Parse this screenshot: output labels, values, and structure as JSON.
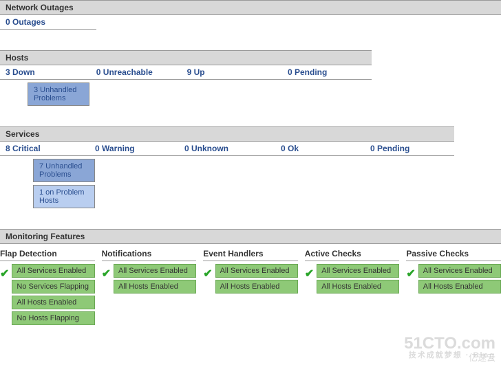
{
  "network_outages": {
    "header": "Network Outages",
    "count_label": "0 Outages"
  },
  "hosts": {
    "header": "Hosts",
    "stats": {
      "down": "3 Down",
      "unreachable": "0 Unreachable",
      "up": "9 Up",
      "pending": "0 Pending"
    },
    "unhandled": "3 Unhandled Problems"
  },
  "services": {
    "header": "Services",
    "stats": {
      "critical": "8 Critical",
      "warning": "0 Warning",
      "unknown": "0 Unknown",
      "ok": "0 Ok",
      "pending": "0 Pending"
    },
    "unhandled": "7 Unhandled Problems",
    "on_problem": "1 on Problem Hosts"
  },
  "monitoring": {
    "header": "Monitoring Features",
    "features": {
      "flap": {
        "title": "Flap Detection",
        "items": [
          "All Services Enabled",
          "No Services Flapping",
          "All Hosts Enabled",
          "No Hosts Flapping"
        ]
      },
      "notifications": {
        "title": "Notifications",
        "items": [
          "All Services Enabled",
          "All Hosts Enabled"
        ]
      },
      "event_handlers": {
        "title": "Event Handlers",
        "items": [
          "All Services Enabled",
          "All Hosts Enabled"
        ]
      },
      "active_checks": {
        "title": "Active Checks",
        "items": [
          "All Services Enabled",
          "All Hosts Enabled"
        ]
      },
      "passive_checks": {
        "title": "Passive Checks",
        "items": [
          "All Services Enabled",
          "All Hosts Enabled"
        ]
      }
    }
  },
  "watermark": {
    "line1": "51CTO.com",
    "line2": "技术成就梦想 · Blog",
    "brand2": "亿速云"
  }
}
